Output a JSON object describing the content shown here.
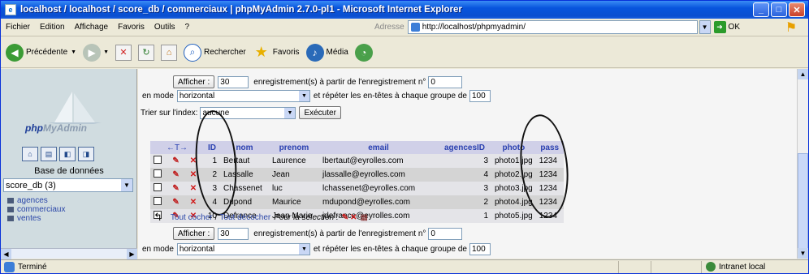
{
  "window": {
    "title": "localhost / localhost / score_db / commerciaux | phpMyAdmin 2.7.0-pl1 - Microsoft Internet Explorer"
  },
  "menu": [
    "Fichier",
    "Edition",
    "Affichage",
    "Favoris",
    "Outils",
    "?"
  ],
  "address": {
    "label": "Adresse",
    "url": "http://localhost/phpmyadmin/",
    "go_label": "OK"
  },
  "toolbar": {
    "back": "Précédente",
    "search": "Rechercher",
    "favorites": "Favoris",
    "media": "Média"
  },
  "sidebar": {
    "logo": {
      "part1": "php",
      "part2": "MyAdmin"
    },
    "db_label": "Base de données",
    "db_selected": "score_db (3)",
    "tables": [
      "agences",
      "commerciaux",
      "ventes"
    ]
  },
  "nav_top": {
    "show_button": "Afficher :",
    "rows_value": "30",
    "records_text": "enregistrement(s) à partir de l'enregistrement n°",
    "start_value": "0",
    "mode_label": "en mode",
    "mode_value": "horizontal",
    "repeat_text": "et répéter les en-têtes à chaque groupe de",
    "repeat_value": "100"
  },
  "sort": {
    "label": "Trier sur l'index:",
    "value": "aucune",
    "exec_button": "Exécuter"
  },
  "table": {
    "arrows": "←T→",
    "headers": [
      "ID",
      "nom",
      "prenom",
      "email",
      "agencesID",
      "photo",
      "pass"
    ],
    "rows": [
      {
        "id": "1",
        "nom": "Bertaut",
        "prenom": "Laurence",
        "email": "lbertaut@eyrolles.com",
        "agencesID": "3",
        "photo": "photo1.jpg",
        "pass": "1234"
      },
      {
        "id": "2",
        "nom": "Lassalle",
        "prenom": "Jean",
        "email": "jlassalle@eyrolles.com",
        "agencesID": "4",
        "photo": "photo2.jpg",
        "pass": "1234"
      },
      {
        "id": "3",
        "nom": "Chassenet",
        "prenom": "luc",
        "email": "lchassenet@eyrolles.com",
        "agencesID": "3",
        "photo": "photo3.jpg",
        "pass": "1234"
      },
      {
        "id": "4",
        "nom": "Dupond",
        "prenom": "Maurice",
        "email": "mdupond@eyrolles.com",
        "agencesID": "2",
        "photo": "photo4.jpg",
        "pass": "1234"
      },
      {
        "id": "10",
        "nom": "Defrance",
        "prenom": "Jean Marie",
        "email": "jdefrance@eyrolles.com",
        "agencesID": "1",
        "photo": "photo5.jpg",
        "pass": "1234"
      }
    ]
  },
  "selection": {
    "check_all": "Tout cocher",
    "uncheck_all": "Tout décocher",
    "for_selection": "Pour la sélection :"
  },
  "nav_bottom": {
    "show_button": "Afficher :",
    "rows_value": "30",
    "records_text": "enregistrement(s) à partir de l'enregistrement n°",
    "start_value": "0",
    "mode_label": "en mode",
    "mode_value": "horizontal",
    "repeat_text": "et répéter les en-têtes à chaque groupe de",
    "repeat_value": "100"
  },
  "status": {
    "left": "Terminé",
    "zone": "Intranet local"
  },
  "colors": {
    "titlebar": "#0a4fd0",
    "header_bg": "#d0d0e8",
    "link": "#2a46a8"
  }
}
